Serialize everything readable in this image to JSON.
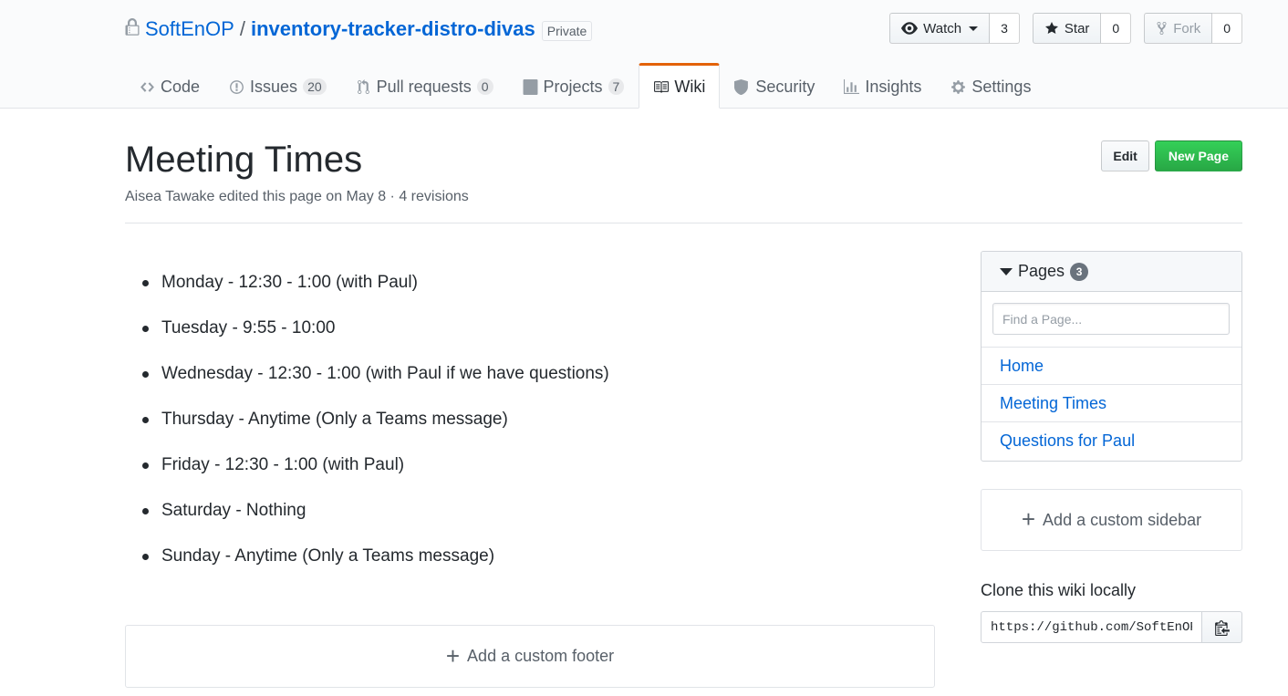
{
  "repo": {
    "owner": "SoftEnOP",
    "separator": "/",
    "name": "inventory-tracker-distro-divas",
    "visibility": "Private"
  },
  "actions": {
    "watch_label": "Watch",
    "watch_count": "3",
    "star_label": "Star",
    "star_count": "0",
    "fork_label": "Fork",
    "fork_count": "0"
  },
  "tabs": [
    {
      "label": "Code",
      "icon": "code-icon"
    },
    {
      "label": "Issues",
      "count": "20",
      "icon": "issue-icon"
    },
    {
      "label": "Pull requests",
      "count": "0",
      "icon": "pull-request-icon"
    },
    {
      "label": "Projects",
      "count": "7",
      "icon": "project-icon"
    },
    {
      "label": "Wiki",
      "icon": "book-icon",
      "selected": true
    },
    {
      "label": "Security",
      "icon": "shield-icon"
    },
    {
      "label": "Insights",
      "icon": "graph-icon"
    },
    {
      "label": "Settings",
      "icon": "gear-icon"
    }
  ],
  "wiki": {
    "title": "Meeting Times",
    "meta": "Aisea Tawake edited this page on May 8 · 4 revisions",
    "edit_label": "Edit",
    "new_page_label": "New Page",
    "items": [
      "Monday - 12:30 - 1:00 (with Paul)",
      "Tuesday - 9:55 - 10:00",
      "Wednesday - 12:30 - 1:00 (with Paul if we have questions)",
      "Thursday - Anytime (Only a Teams message)",
      "Friday - 12:30 - 1:00 (with Paul)",
      "Saturday - Nothing",
      "Sunday - Anytime (Only a Teams message)"
    ],
    "footer_label": "Add a custom footer"
  },
  "sidebar": {
    "pages_label": "Pages",
    "pages_count": "3",
    "filter_placeholder": "Find a Page...",
    "pages": [
      "Home",
      "Meeting Times",
      "Questions for Paul"
    ],
    "custom_sidebar_label": "Add a custom sidebar",
    "clone_title": "Clone this wiki locally",
    "clone_url": "https://github.com/SoftEnOP"
  },
  "colors": {
    "link": "#0366d6",
    "selected_tab_accent": "#e36209",
    "primary_button": "#28a745"
  }
}
